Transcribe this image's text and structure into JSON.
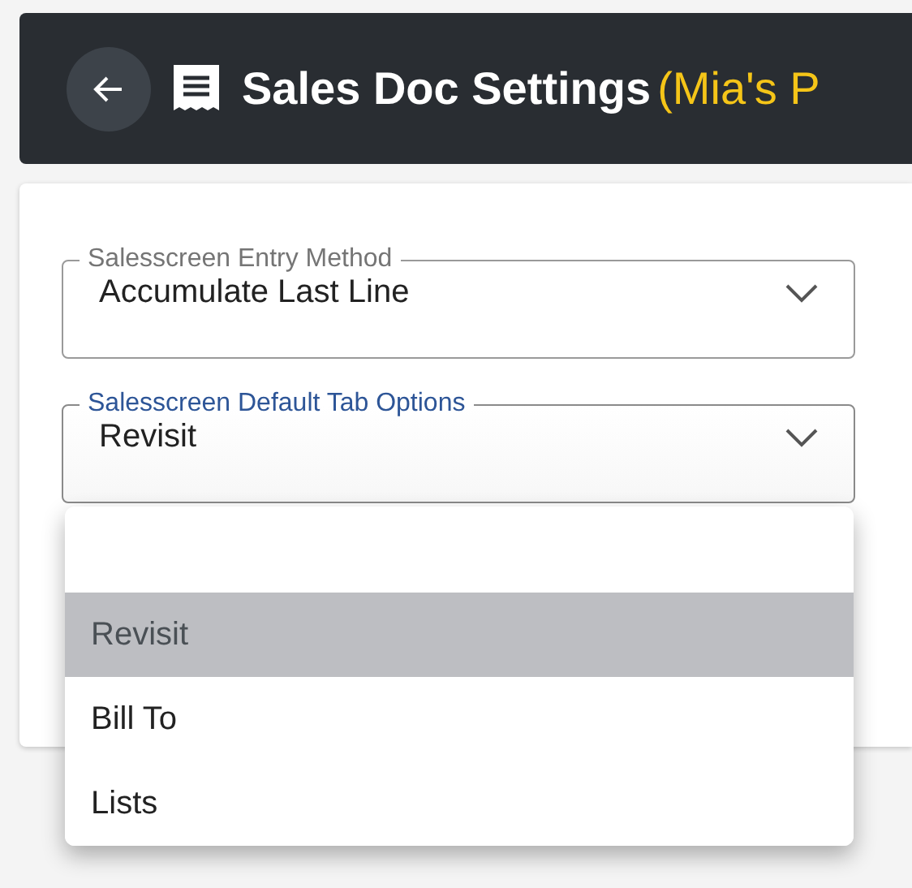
{
  "header": {
    "title": "Sales Doc Settings",
    "subtitle": "(Mia's P"
  },
  "fields": [
    {
      "label": "Salesscreen Entry Method",
      "value": "Accumulate Last Line",
      "focused": false
    },
    {
      "label": "Salesscreen Default Tab Options",
      "value": "Revisit",
      "focused": true
    }
  ],
  "menu": {
    "options": [
      {
        "label": "Revisit",
        "selected": true
      },
      {
        "label": "Bill To",
        "selected": false
      },
      {
        "label": "Lists",
        "selected": false
      }
    ]
  }
}
